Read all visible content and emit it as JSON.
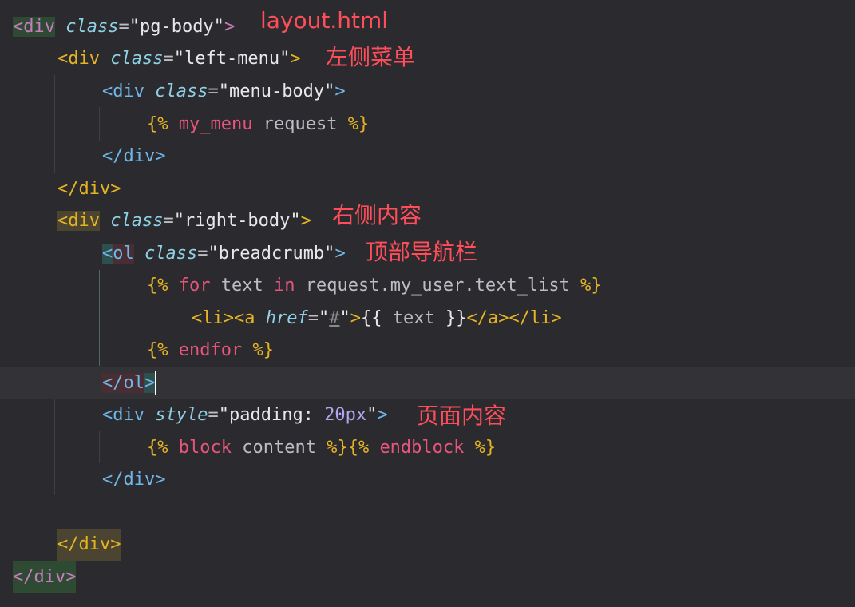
{
  "editor": {
    "lines": {
      "l1": {
        "open": "<div",
        "attr": "class",
        "eq": "=",
        "val": "\"pg-body\"",
        "close": ">"
      },
      "l2": {
        "open": "<div",
        "attr": "class",
        "eq": "=",
        "val": "\"left-menu\"",
        "close": ">"
      },
      "l3": {
        "open": "<div",
        "attr": "class",
        "eq": "=",
        "val": "\"menu-body\"",
        "close": ">"
      },
      "l4": {
        "tpl_open": "{%",
        "func": "my_menu",
        "arg": "request",
        "tpl_close": "%}"
      },
      "l5": {
        "text": "</div>"
      },
      "l6": {
        "text": "</div>"
      },
      "l7": {
        "open": "<div",
        "attr": "class",
        "eq": "=",
        "val": "\"right-body\"",
        "close": ">"
      },
      "l8": {
        "lt": "<",
        "tag": "ol",
        "attr": "class",
        "eq": "=",
        "val": "\"breadcrumb\"",
        "close": ">"
      },
      "l9": {
        "tpl_open": "{%",
        "kw_for": "for",
        "var": "text",
        "kw_in": "in",
        "expr": "request.my_user.text_list",
        "tpl_close": "%}"
      },
      "l10": {
        "li_open": "<li>",
        "a_open": "<a",
        "attr": "href",
        "eq": "=",
        "q1": "\"",
        "hash": "#",
        "q2": "\"",
        "gt": ">",
        "var_open": "{{",
        "var": "text",
        "var_close": "}}",
        "a_close": "</a>",
        "li_close": "</li>"
      },
      "l11": {
        "tpl_open": "{%",
        "kw": "endfor",
        "tpl_close": "%}"
      },
      "l12": {
        "close_open": "</ol",
        "gt": ">"
      },
      "l13": {
        "open": "<div",
        "attr": "style",
        "eq": "=",
        "q1": "\"",
        "prop": "padding:",
        "num": "20px",
        "q2": "\"",
        "close": ">"
      },
      "l14": {
        "tpl_open": "{%",
        "kw": "block",
        "name": "content",
        "tpl_mid": "%}{%",
        "kw2": "endblock",
        "tpl_close": "%}"
      },
      "l15": {
        "text": "</div>"
      },
      "l17": {
        "text": "</div>"
      },
      "l18": {
        "text": "</div>"
      }
    }
  },
  "annotations": {
    "layout_file": "layout.html",
    "left_menu": "左侧菜单",
    "right_body": "右侧内容",
    "breadcrumb": "顶部导航栏",
    "page_content": "页面内容"
  },
  "colors": {
    "background": "#2b2b2f",
    "current_line": "#323237",
    "annotation": "#ff4d5a",
    "template_delimiter": "#e6b422",
    "keyword": "#e8557a",
    "attribute": "#8fd0e4"
  }
}
